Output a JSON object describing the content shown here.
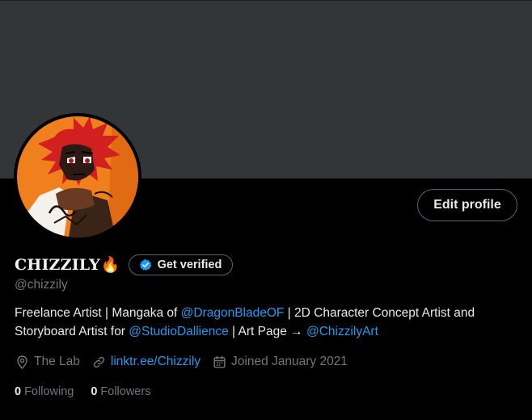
{
  "profile": {
    "display_name": "CHIZZILY",
    "name_emoji": "🔥",
    "handle": "@chizzily",
    "edit_label": "Edit profile",
    "verify_label": "Get verified"
  },
  "bio": {
    "line1_pre": "Freelance Artist | Mangaka of ",
    "mention1": "@DragonBladeOF",
    "line1_post": " | 2D Character Concept Artist and Storyboard Artist for ",
    "mention2": "@StudioDallience",
    "mid": " | Art Page → ",
    "mention3": "@ChizzilyArt"
  },
  "meta": {
    "location": "The Lab",
    "link": "linktr.ee/Chizzily",
    "joined": "Joined January 2021"
  },
  "stats": {
    "following_count": "0",
    "following_label": "Following",
    "followers_count": "0",
    "followers_label": "Followers"
  },
  "colors": {
    "background": "#000000",
    "banner": "#333639",
    "accent": "#1d9bf0",
    "secondary_text": "#71767b",
    "primary_text": "#e7e9ea"
  },
  "icons": {
    "location": "location-pin-icon",
    "link": "link-icon",
    "calendar": "calendar-icon",
    "verified": "verified-badge-icon"
  }
}
